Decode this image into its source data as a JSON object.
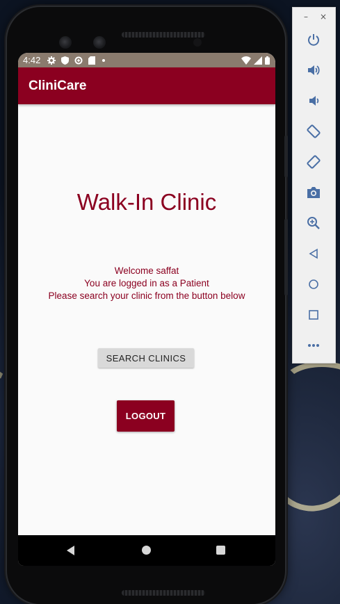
{
  "status_bar": {
    "time": "4:42"
  },
  "app_bar": {
    "title": "CliniCare"
  },
  "main": {
    "heading": "Walk-In Clinic",
    "welcome_line": "Welcome saffat",
    "role_line": "You are logged in as a Patient",
    "instruction_line": "Please search your clinic from the button below",
    "search_button_label": "SEARCH CLINICS",
    "logout_button_label": "LOGOUT"
  },
  "emulator_toolbar": {
    "minimize_label": "–",
    "close_label": "×",
    "tools": [
      "power-icon",
      "volume-up-icon",
      "volume-down-icon",
      "rotate-left-icon",
      "rotate-right-icon",
      "camera-icon",
      "zoom-icon",
      "back-icon",
      "home-icon",
      "overview-icon",
      "more-icon"
    ]
  },
  "colors": {
    "primary": "#8b0020",
    "status_bar": "#8a7b6e",
    "toolbar_icon": "#4a6fa5"
  }
}
